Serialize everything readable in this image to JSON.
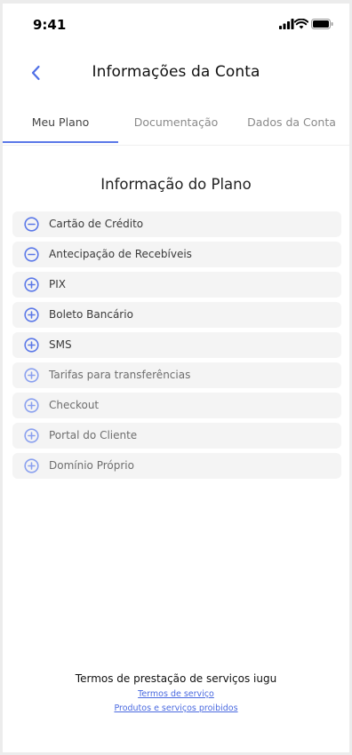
{
  "status_bar": {
    "time": "9:41"
  },
  "header": {
    "title": "Informações da Conta"
  },
  "tabs": [
    {
      "label": "Meu Plano",
      "active": true
    },
    {
      "label": "Documentação",
      "active": false
    },
    {
      "label": "Dados da Conta",
      "active": false
    }
  ],
  "plan": {
    "title": "Informação do Plano",
    "items": [
      {
        "label": "Cartão de Crédito",
        "icon": "minus-circle-icon",
        "state": "expanded"
      },
      {
        "label": "Antecipação de Recebíveis",
        "icon": "minus-circle-icon",
        "state": "expanded"
      },
      {
        "label": "PIX",
        "icon": "plus-circle-icon",
        "state": "collapsed"
      },
      {
        "label": "Boleto Bancário",
        "icon": "plus-circle-icon",
        "state": "collapsed"
      },
      {
        "label": "SMS",
        "icon": "plus-circle-icon",
        "state": "collapsed"
      },
      {
        "label": "Tarifas para transferências",
        "icon": "plus-circle-icon",
        "state": "muted"
      },
      {
        "label": "Checkout",
        "icon": "plus-circle-icon",
        "state": "muted"
      },
      {
        "label": "Portal do Cliente",
        "icon": "plus-circle-icon",
        "state": "muted"
      },
      {
        "label": "Domínio Próprio",
        "icon": "plus-circle-icon",
        "state": "muted"
      }
    ]
  },
  "footer": {
    "title": "Termos de prestação de serviços iugu",
    "links": [
      "Termos de serviço",
      "Produtos e serviços proibidos"
    ]
  },
  "colors": {
    "accent": "#5b78e8",
    "muted_accent": "#8aa0ef",
    "item_bg": "#f4f4f4"
  }
}
